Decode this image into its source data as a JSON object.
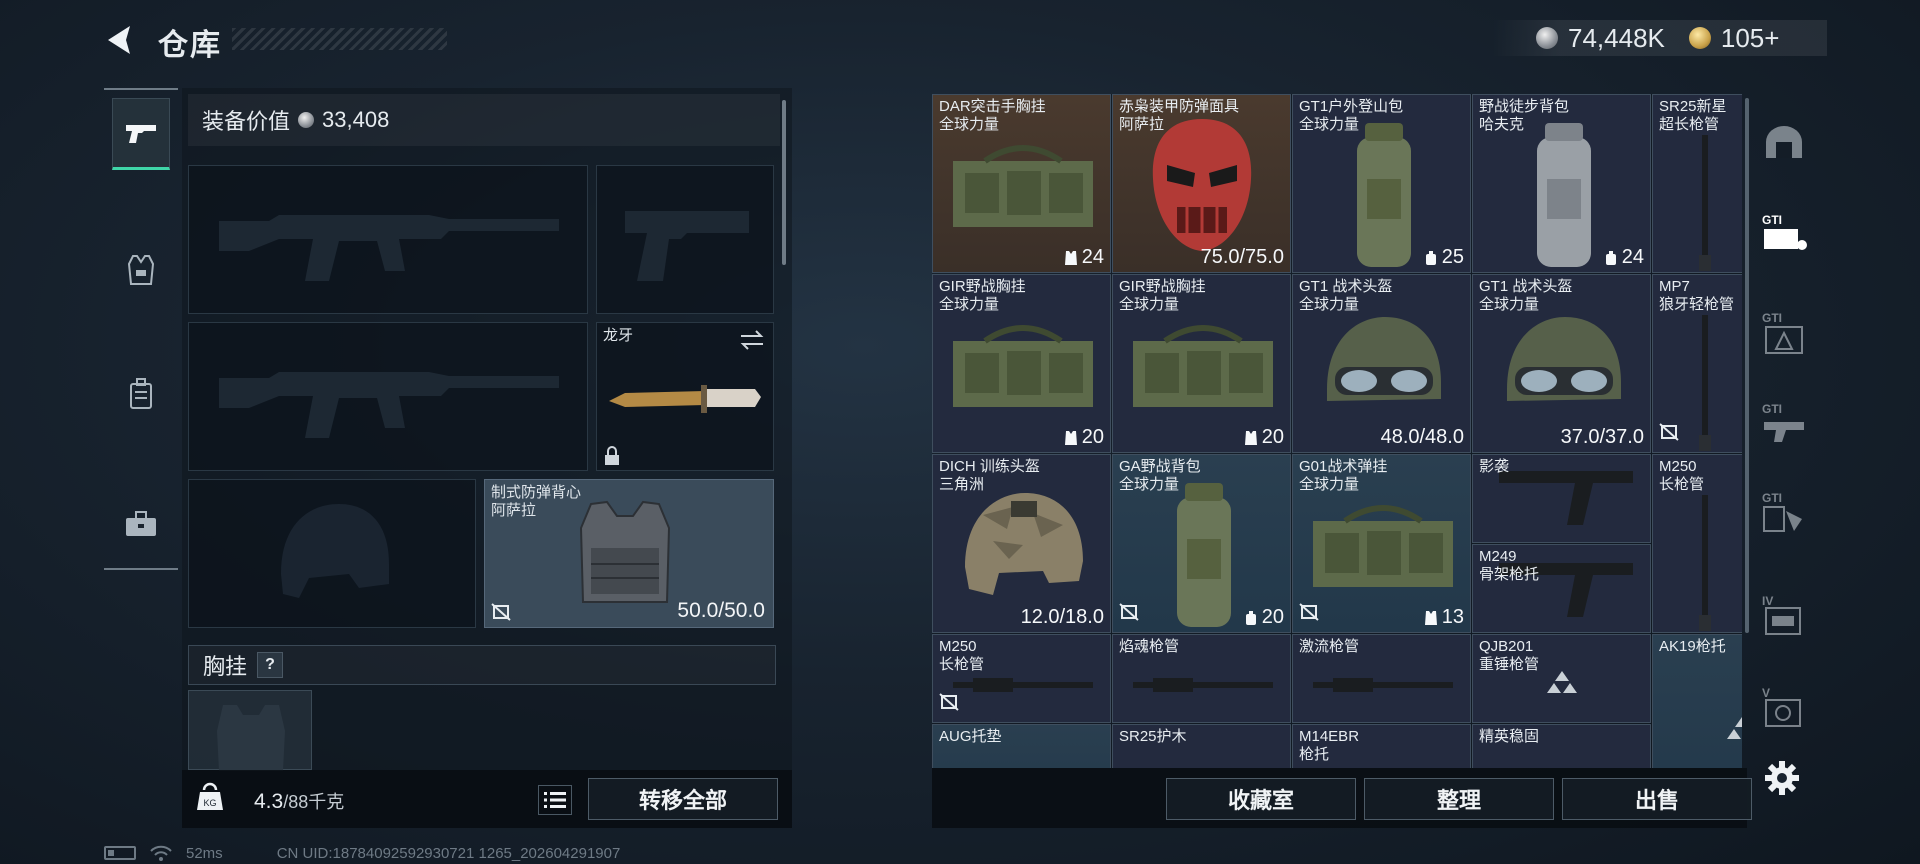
{
  "header": {
    "title": "仓库",
    "silver": "74,448K",
    "gold": "105+"
  },
  "left_rail": {
    "categories": [
      "weapon",
      "vest",
      "backpack",
      "toolbox"
    ],
    "active": "weapon"
  },
  "loadout": {
    "equip_value_label": "装备价值",
    "equip_value": "33,408",
    "melee": {
      "name": "龙牙"
    },
    "armor": {
      "name": "制式防弹背心",
      "brand": "阿萨拉",
      "condition": "50.0/50.0"
    },
    "chest_rig_label": "胸挂",
    "help": "?",
    "weight": "4.3",
    "weight_cap": "/88千克",
    "transfer_all": "转移全部"
  },
  "grid": {
    "rows": [
      [
        {
          "name": "DAR突击手胸挂",
          "sub": "全球力量",
          "qty": "24",
          "qty_icon": "vest",
          "bg": "brown",
          "art": "bag"
        },
        {
          "name": "赤枭装甲防弹面具",
          "sub": "阿萨拉",
          "qty": "75.0/75.0",
          "qty_icon": "",
          "bg": "brown",
          "art": "mask"
        },
        {
          "name": "GT1户外登山包",
          "sub": "全球力量",
          "qty": "25",
          "qty_icon": "pack",
          "bg": "",
          "art": "pack"
        },
        {
          "name": "野战徒步背包",
          "sub": "哈夫克",
          "qty": "24",
          "qty_icon": "pack",
          "bg": "",
          "art": "pack-grey"
        },
        {
          "name": "SR25新星",
          "sub": "超长枪管",
          "qty": "",
          "qty_icon": "",
          "bg": "",
          "art": "barrel-v"
        }
      ],
      [
        {
          "name": "GIR野战胸挂",
          "sub": "全球力量",
          "qty": "20",
          "qty_icon": "vest",
          "bg": "",
          "art": "bag"
        },
        {
          "name": "GIR野战胸挂",
          "sub": "全球力量",
          "qty": "20",
          "qty_icon": "vest",
          "bg": "",
          "art": "bag"
        },
        {
          "name": "GT1 战术头盔",
          "sub": "全球力量",
          "qty": "48.0/48.0",
          "qty_icon": "",
          "bg": "",
          "art": "helmet"
        },
        {
          "name": "GT1 战术头盔",
          "sub": "全球力量",
          "qty": "37.0/37.0",
          "qty_icon": "",
          "bg": "",
          "art": "helmet"
        },
        {
          "name": "MP7",
          "sub": "狼牙轻枪管",
          "qty": "",
          "qty_icon": "",
          "bg": "",
          "art": "barrel-v"
        }
      ],
      [
        {
          "name": "DICH 训练头盔",
          "sub": "三角洲",
          "qty": "12.0/18.0",
          "qty_icon": "",
          "bg": "",
          "art": "helmet-camo"
        },
        {
          "name": "GA野战背包",
          "sub": "全球力量",
          "qty": "20",
          "qty_icon": "pack",
          "bg": "teal",
          "art": "pack"
        },
        {
          "name": "G01战术弹挂",
          "sub": "全球力量",
          "qty": "13",
          "qty_icon": "vest",
          "bg": "teal",
          "art": "bag"
        },
        {
          "name": "影袭",
          "sub": "",
          "qty": "",
          "qty_icon": "",
          "bg": "",
          "art": "stock"
        },
        {
          "name": "M250",
          "sub": "长枪管",
          "qty": "",
          "qty_icon": "",
          "bg": "",
          "art": "barrel-v"
        }
      ]
    ],
    "m249": {
      "name": "M249",
      "sub": "骨架枪托"
    },
    "row4": [
      {
        "name": "M250",
        "sub": "长枪管"
      },
      {
        "name": "焰魂枪管",
        "sub": ""
      },
      {
        "name": "激流枪管",
        "sub": ""
      },
      {
        "name": "QJB201",
        "sub": "重锤枪管"
      },
      {
        "name": "AK19枪托",
        "sub": ""
      }
    ],
    "row5": [
      {
        "name": "AUG托垫",
        "sub": ""
      },
      {
        "name": "SR25护木",
        "sub": ""
      },
      {
        "name": "M14EBR",
        "sub": "枪托"
      },
      {
        "name": "精英稳固",
        "sub": ""
      }
    ]
  },
  "right_rail": {
    "tabs": [
      "helmet-tab",
      "gti-bag-tab",
      "gti-vest-tab",
      "gti-gun-tab",
      "gti-hand-tab",
      "iv-tab",
      "v-tab"
    ],
    "active": "gti-bag-tab"
  },
  "actions": {
    "collection": "收藏室",
    "sort": "整理",
    "sell": "出售"
  },
  "status": {
    "ping": "52ms",
    "uid": "CN UID:18784092592930721 1265_202604291907"
  }
}
